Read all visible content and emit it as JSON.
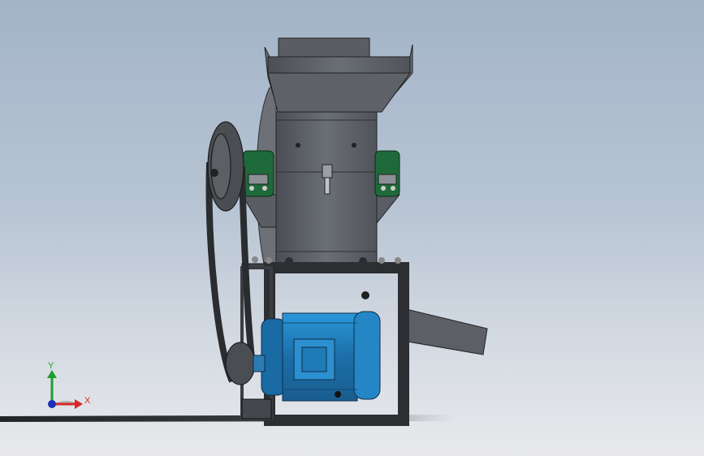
{
  "scene": {
    "model": "crusher-machine-assembly",
    "view": "front"
  },
  "triad": {
    "x_label": "X",
    "y_label": "Y",
    "x_color": "#d62828",
    "y_color": "#1f9d2e",
    "z_color": "#1c2fb8"
  },
  "colors": {
    "body_steel": "#55595f",
    "hopper_steel": "#62666d",
    "bearing_green": "#1f6a3a",
    "motor_blue": "#1e7fc2",
    "frame_dark": "#3f4247",
    "belt": "#2a2c30",
    "floor_shadow": "#1c1e22"
  }
}
